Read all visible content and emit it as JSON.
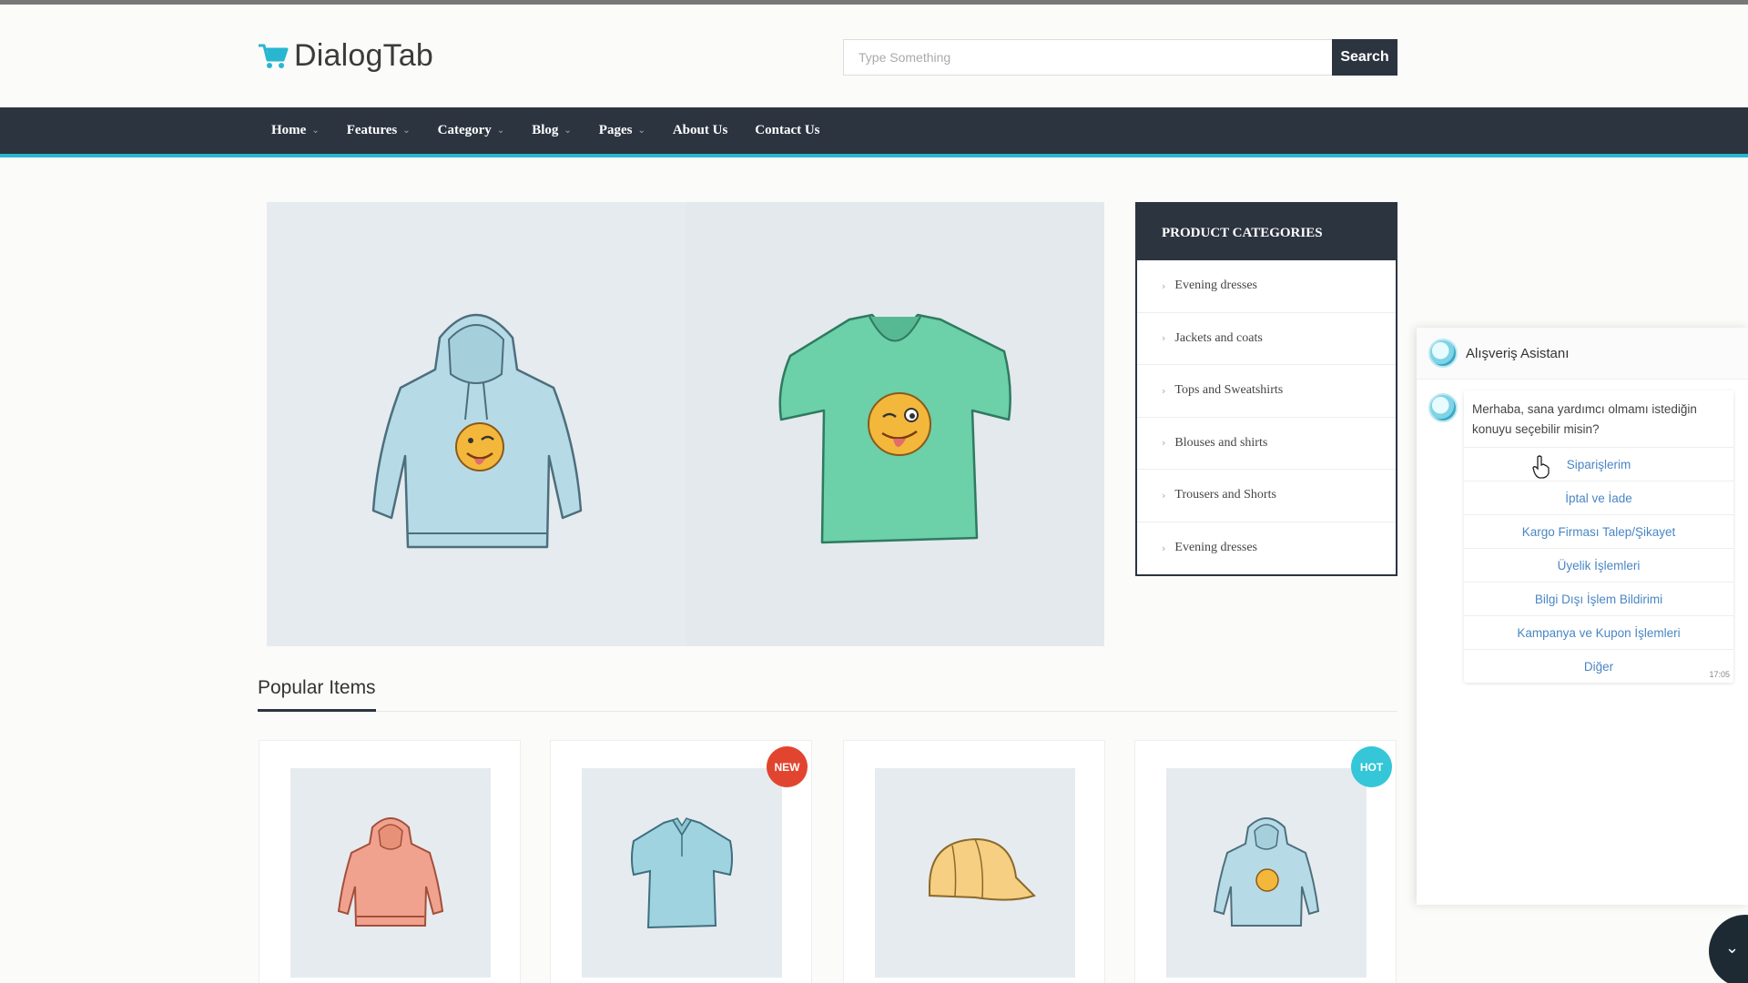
{
  "header": {
    "brand": "DialogTab",
    "search_placeholder": "Type Something",
    "search_button": "Search"
  },
  "nav": {
    "items": [
      {
        "label": "Home",
        "has_dropdown": true
      },
      {
        "label": "Features",
        "has_dropdown": true
      },
      {
        "label": "Category",
        "has_dropdown": true
      },
      {
        "label": "Blog",
        "has_dropdown": true
      },
      {
        "label": "Pages",
        "has_dropdown": true
      },
      {
        "label": "About Us",
        "has_dropdown": false
      },
      {
        "label": "Contact Us",
        "has_dropdown": false
      }
    ]
  },
  "categories": {
    "title": "PRODUCT CATEGORIES",
    "items": [
      "Evening dresses",
      "Jackets and coats",
      "Tops and Sweatshirts",
      "Blouses and shirts",
      "Trousers and Shorts",
      "Evening dresses"
    ]
  },
  "popular": {
    "title": "Popular Items",
    "badges": {
      "new": "NEW",
      "hot": "HOT"
    }
  },
  "chat": {
    "title": "Alışveriş Asistanı",
    "message": "Merhaba, sana yardımcı olmamı istediğin konuyu seçebilir misin?",
    "options": [
      "Siparişlerim",
      "İptal ve İade",
      "Kargo Firması Talep/Şikayet",
      "Üyelik İşlemleri",
      "Bilgi Dışı İşlem Bildirimi",
      "Kampanya ve Kupon İşlemleri",
      "Diğer"
    ],
    "time": "17:05"
  },
  "colors": {
    "nav_bg": "#2c3440",
    "accent": "#29b6d0",
    "new_badge": "#e2452f",
    "hot_badge": "#35c6d8",
    "link": "#4a86c5"
  },
  "icons": [
    "cart-icon",
    "chevron-down-icon",
    "chevron-right-icon",
    "assistant-avatar-icon",
    "pointer-cursor-icon"
  ]
}
